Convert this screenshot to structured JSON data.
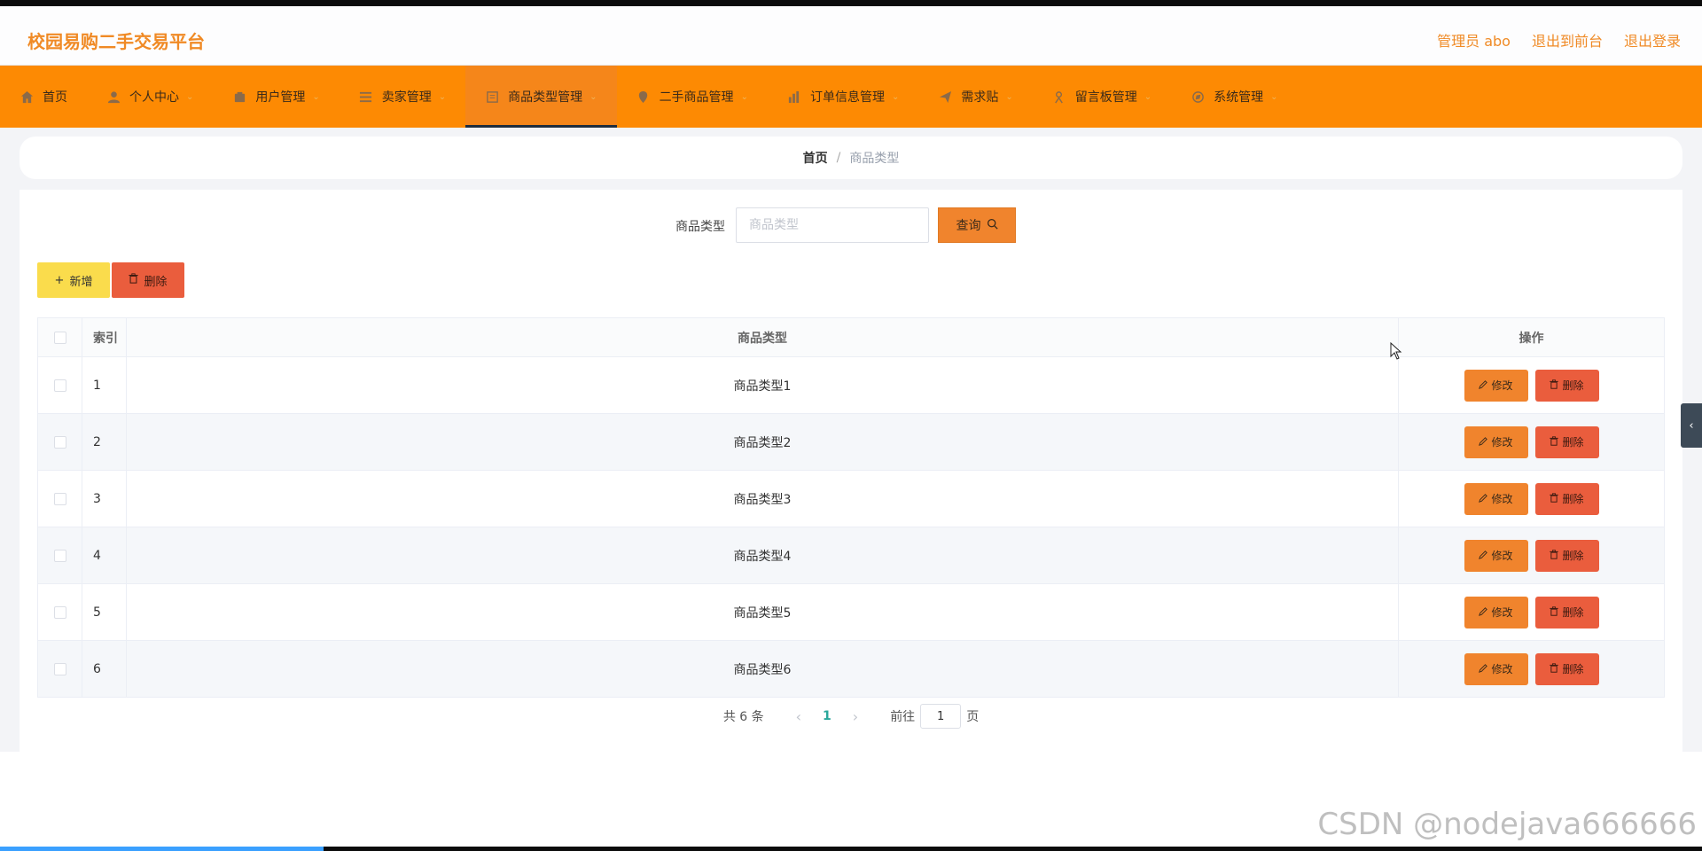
{
  "header": {
    "brand": "校园易购二手交易平台",
    "admin_label": "管理员 abo",
    "to_front_label": "退出到前台",
    "logout_label": "退出登录"
  },
  "nav": {
    "items": [
      {
        "label": "首页",
        "icon": "home-icon"
      },
      {
        "label": "个人中心",
        "icon": "user-icon"
      },
      {
        "label": "用户管理",
        "icon": "users-icon"
      },
      {
        "label": "卖家管理",
        "icon": "list-icon"
      },
      {
        "label": "商品类型管理",
        "icon": "document-icon",
        "active": true
      },
      {
        "label": "二手商品管理",
        "icon": "tag-icon"
      },
      {
        "label": "订单信息管理",
        "icon": "chart-icon"
      },
      {
        "label": "需求贴",
        "icon": "send-icon"
      },
      {
        "label": "留言板管理",
        "icon": "message-icon"
      },
      {
        "label": "系统管理",
        "icon": "settings-icon"
      }
    ]
  },
  "breadcrumb": {
    "home": "首页",
    "separator": "/",
    "current": "商品类型"
  },
  "search": {
    "label": "商品类型",
    "placeholder": "商品类型",
    "value": "",
    "button_label": "查询"
  },
  "actions": {
    "add_label": "新增",
    "delete_label": "删除"
  },
  "table": {
    "headers": {
      "index": "索引",
      "type": "商品类型",
      "ops": "操作"
    },
    "edit_label": "修改",
    "delete_label": "删除",
    "rows": [
      {
        "index": "1",
        "type": "商品类型1"
      },
      {
        "index": "2",
        "type": "商品类型2"
      },
      {
        "index": "3",
        "type": "商品类型3"
      },
      {
        "index": "4",
        "type": "商品类型4"
      },
      {
        "index": "5",
        "type": "商品类型5"
      },
      {
        "index": "6",
        "type": "商品类型6"
      }
    ]
  },
  "pagination": {
    "total": "共 6 条",
    "current_page": "1",
    "goto_label": "前往",
    "goto_value": "1",
    "page_suffix": "页"
  },
  "watermark": "CSDN @nodejava666666",
  "video_progress": 0.19,
  "colors": {
    "accent": "#f08a25",
    "nav_bg": "#fd8a03",
    "edit_btn": "#f0842d",
    "delete_btn": "#ea5d3d",
    "add_btn": "#fadc4c",
    "active_page": "#2aa79b"
  }
}
